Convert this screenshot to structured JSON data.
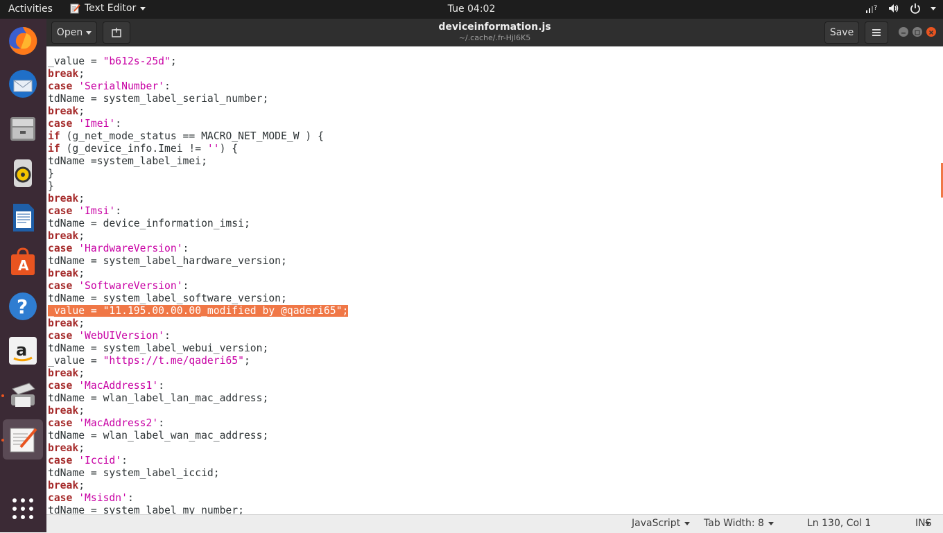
{
  "topbar": {
    "activities": "Activities",
    "app_name": "Text Editor",
    "clock": "Tue 04:02"
  },
  "dock": {
    "items": [
      {
        "name": "firefox"
      },
      {
        "name": "thunderbird"
      },
      {
        "name": "files"
      },
      {
        "name": "rhythmbox"
      },
      {
        "name": "libreoffice-writer"
      },
      {
        "name": "ubuntu-software"
      },
      {
        "name": "help"
      },
      {
        "name": "amazon"
      },
      {
        "name": "printer"
      },
      {
        "name": "text-editor"
      },
      {
        "name": "show-applications"
      }
    ]
  },
  "header": {
    "open_label": "Open",
    "title": "deviceinformation.js",
    "subtitle": "~/.cache/.fr-Hjl6K5",
    "save_label": "Save"
  },
  "editor": {
    "lines": [
      [
        {
          "t": "",
          "c": ""
        }
      ],
      [
        {
          "t": "_value = ",
          "c": ""
        },
        {
          "t": "\"b612s-25d\"",
          "c": "str"
        },
        {
          "t": ";",
          "c": ""
        }
      ],
      [
        {
          "t": "break",
          "c": "kw"
        },
        {
          "t": ";",
          "c": ""
        }
      ],
      [
        {
          "t": "case",
          "c": "kw"
        },
        {
          "t": " ",
          "c": ""
        },
        {
          "t": "'SerialNumber'",
          "c": "str"
        },
        {
          "t": ":",
          "c": ""
        }
      ],
      [
        {
          "t": "tdName = system_label_serial_number;",
          "c": ""
        }
      ],
      [
        {
          "t": "break",
          "c": "kw"
        },
        {
          "t": ";",
          "c": ""
        }
      ],
      [
        {
          "t": "case",
          "c": "kw"
        },
        {
          "t": " ",
          "c": ""
        },
        {
          "t": "'Imei'",
          "c": "str"
        },
        {
          "t": ":",
          "c": ""
        }
      ],
      [
        {
          "t": "if",
          "c": "kw"
        },
        {
          "t": " (g_net_mode_status == MACRO_NET_MODE_W ) {",
          "c": ""
        }
      ],
      [
        {
          "t": "if",
          "c": "kw"
        },
        {
          "t": " (g_device_info.Imei != ",
          "c": ""
        },
        {
          "t": "''",
          "c": "str"
        },
        {
          "t": ") {",
          "c": ""
        }
      ],
      [
        {
          "t": "tdName =system_label_imei;",
          "c": ""
        }
      ],
      [
        {
          "t": "}",
          "c": ""
        }
      ],
      [
        {
          "t": "}",
          "c": ""
        }
      ],
      [
        {
          "t": "break",
          "c": "kw"
        },
        {
          "t": ";",
          "c": ""
        }
      ],
      [
        {
          "t": "case",
          "c": "kw"
        },
        {
          "t": " ",
          "c": ""
        },
        {
          "t": "'Imsi'",
          "c": "str"
        },
        {
          "t": ":",
          "c": ""
        }
      ],
      [
        {
          "t": "tdName = device_information_imsi;",
          "c": ""
        }
      ],
      [
        {
          "t": "break",
          "c": "kw"
        },
        {
          "t": ";",
          "c": ""
        }
      ],
      [
        {
          "t": "case",
          "c": "kw"
        },
        {
          "t": " ",
          "c": ""
        },
        {
          "t": "'HardwareVersion'",
          "c": "str"
        },
        {
          "t": ":",
          "c": ""
        }
      ],
      [
        {
          "t": "tdName = system_label_hardware_version;",
          "c": ""
        }
      ],
      [
        {
          "t": "break",
          "c": "kw"
        },
        {
          "t": ";",
          "c": ""
        }
      ],
      [
        {
          "t": "case",
          "c": "kw"
        },
        {
          "t": " ",
          "c": ""
        },
        {
          "t": "'SoftwareVersion'",
          "c": "str"
        },
        {
          "t": ":",
          "c": ""
        }
      ],
      [
        {
          "t": "tdName = system_label_software_version;",
          "c": ""
        }
      ],
      [
        {
          "t": "_value = \"11.195.00.00.00_modified by @qaderi65\";",
          "c": "sel"
        }
      ],
      [
        {
          "t": "break",
          "c": "kw"
        },
        {
          "t": ";",
          "c": ""
        }
      ],
      [
        {
          "t": "case",
          "c": "kw"
        },
        {
          "t": " ",
          "c": ""
        },
        {
          "t": "'WebUIVersion'",
          "c": "str"
        },
        {
          "t": ":",
          "c": ""
        }
      ],
      [
        {
          "t": "tdName = system_label_webui_version;",
          "c": ""
        }
      ],
      [
        {
          "t": "_value = ",
          "c": ""
        },
        {
          "t": "\"https://t.me/qaderi65\"",
          "c": "str"
        },
        {
          "t": ";",
          "c": ""
        }
      ],
      [
        {
          "t": "break",
          "c": "kw"
        },
        {
          "t": ";",
          "c": ""
        }
      ],
      [
        {
          "t": "case",
          "c": "kw"
        },
        {
          "t": " ",
          "c": ""
        },
        {
          "t": "'MacAddress1'",
          "c": "str"
        },
        {
          "t": ":",
          "c": ""
        }
      ],
      [
        {
          "t": "tdName = wlan_label_lan_mac_address;",
          "c": ""
        }
      ],
      [
        {
          "t": "break",
          "c": "kw"
        },
        {
          "t": ";",
          "c": ""
        }
      ],
      [
        {
          "t": "case",
          "c": "kw"
        },
        {
          "t": " ",
          "c": ""
        },
        {
          "t": "'MacAddress2'",
          "c": "str"
        },
        {
          "t": ":",
          "c": ""
        }
      ],
      [
        {
          "t": "tdName = wlan_label_wan_mac_address;",
          "c": ""
        }
      ],
      [
        {
          "t": "break",
          "c": "kw"
        },
        {
          "t": ";",
          "c": ""
        }
      ],
      [
        {
          "t": "case",
          "c": "kw"
        },
        {
          "t": " ",
          "c": ""
        },
        {
          "t": "'Iccid'",
          "c": "str"
        },
        {
          "t": ":",
          "c": ""
        }
      ],
      [
        {
          "t": "tdName = system_label_iccid;",
          "c": ""
        }
      ],
      [
        {
          "t": "break",
          "c": "kw"
        },
        {
          "t": ";",
          "c": ""
        }
      ],
      [
        {
          "t": "case",
          "c": "kw"
        },
        {
          "t": " ",
          "c": ""
        },
        {
          "t": "'Msisdn'",
          "c": "str"
        },
        {
          "t": ":",
          "c": ""
        }
      ],
      [
        {
          "t": "tdName = system_label_my_number;",
          "c": ""
        }
      ],
      [
        {
          "t": "",
          "c": ""
        }
      ]
    ]
  },
  "statusbar": {
    "language": "JavaScript",
    "tab_width": "Tab Width: 8",
    "position": "Ln 130, Col 1",
    "mode": "INS"
  },
  "colors": {
    "selection": "#f07746",
    "keyword": "#a52a2a",
    "string": "#c800a4",
    "dock_bg": "#3b2a35",
    "header_bg": "#2f2f2f"
  }
}
